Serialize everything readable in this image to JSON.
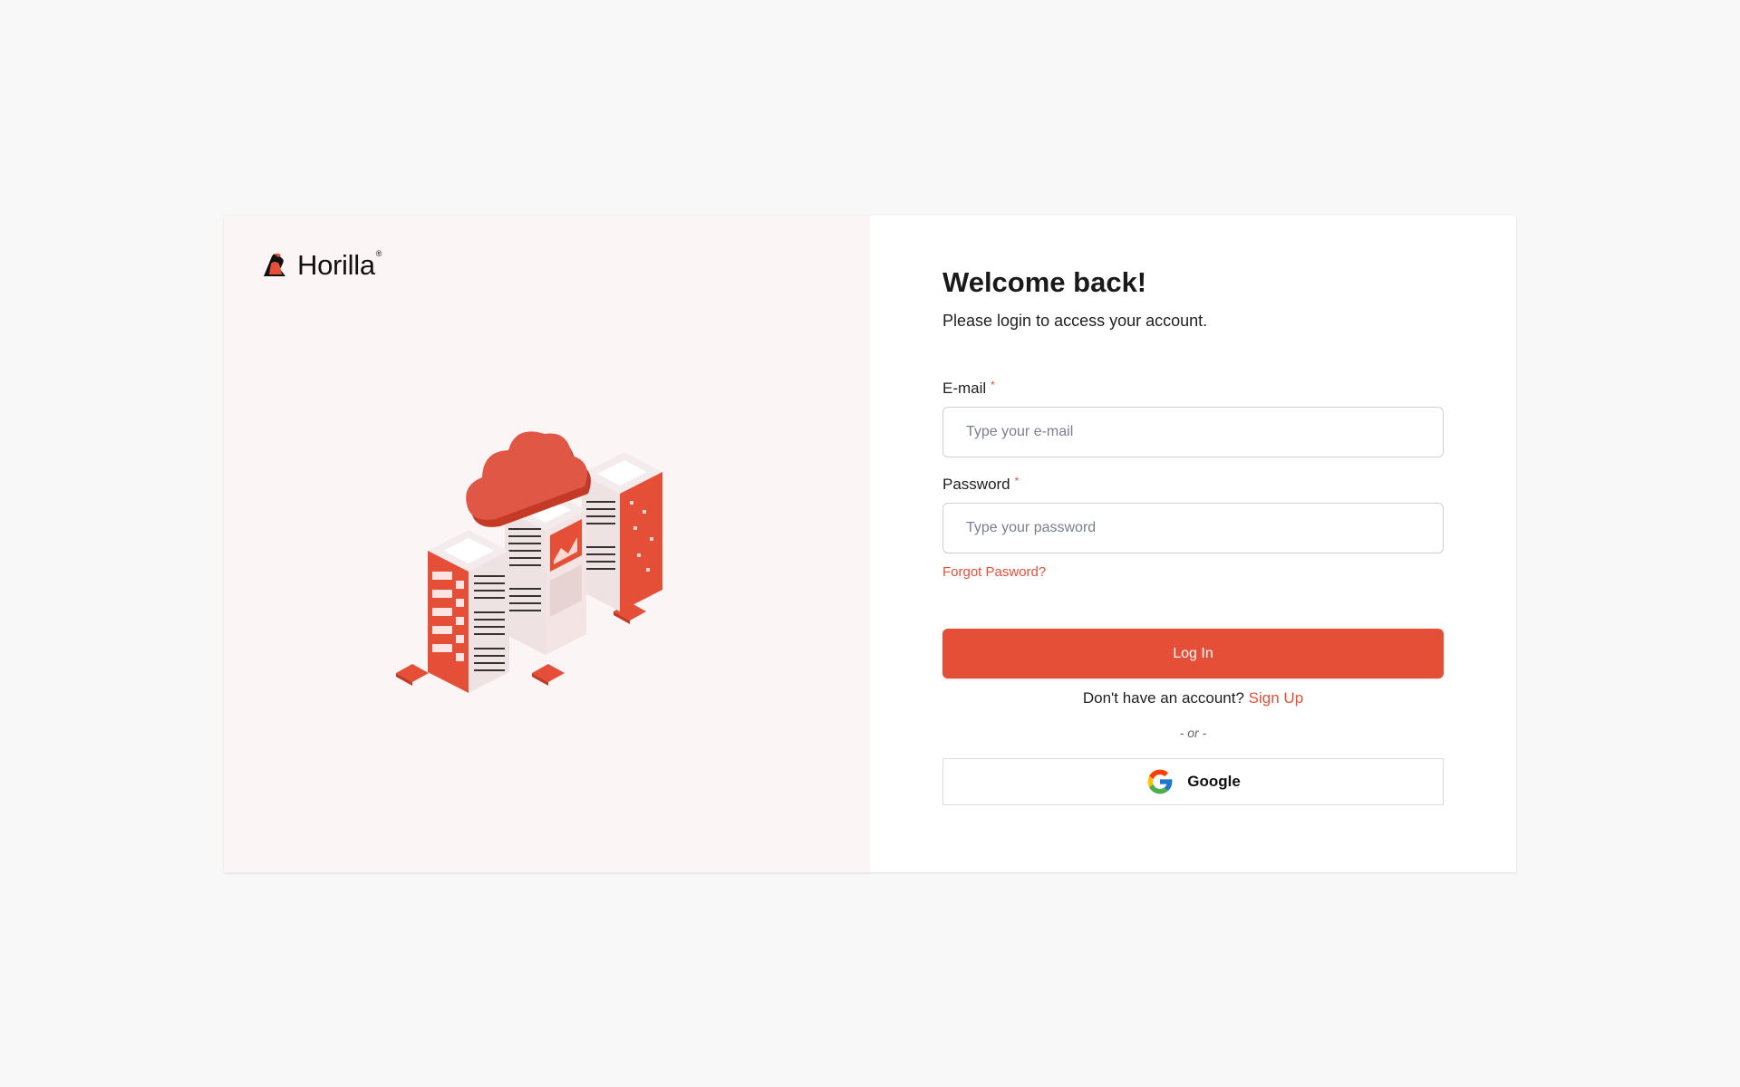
{
  "brand": {
    "name": "Horilla",
    "reg": "®"
  },
  "login": {
    "title": "Welcome back!",
    "subtitle": "Please login to access your account.",
    "email_label": "E-mail",
    "email_placeholder": "Type your e-mail",
    "email_value": "",
    "password_label": "Password",
    "password_placeholder": "Type your password",
    "password_value": "",
    "required_mark": "*",
    "forgot_label": "Forgot Pasword?",
    "login_button": "Log In",
    "no_account_text": "Don't have an account?",
    "signup_link": "Sign Up",
    "or_text": "- or -",
    "google_button": "Google"
  },
  "icons": {
    "logo": "horilla-logo-icon",
    "google": "google-icon",
    "illustration": "cloud-server-illustration"
  },
  "colors": {
    "accent": "#e54f38",
    "left_panel_bg": "#fcf5f5",
    "page_bg": "#f8f8f8"
  }
}
